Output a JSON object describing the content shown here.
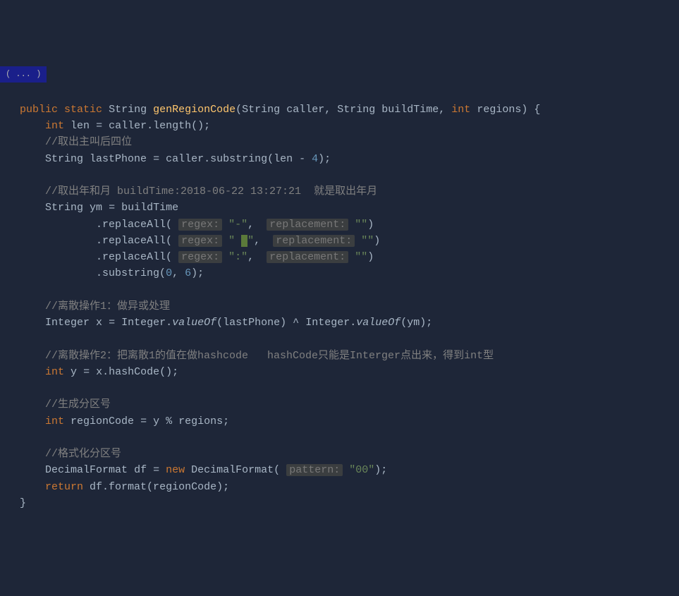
{
  "breadcrumb": "( ... )",
  "line1": {
    "kw_public": "public",
    "kw_static": "static",
    "type_string": "String",
    "method": "genRegionCode",
    "p1_type": "String",
    "p1_name": "caller",
    "p2_type": "String",
    "p2_name": "buildTime",
    "p3_type": "int",
    "p3_name": "regions"
  },
  "line2": {
    "kw_int": "int",
    "var": "len",
    "op": "=",
    "expr": "caller.length();"
  },
  "comment1": "//取出主叫后四位",
  "line3": {
    "type": "String",
    "var": "lastPhone",
    "op": "=",
    "expr_pre": "caller.substring(len - ",
    "num": "4",
    "expr_post": ");"
  },
  "comment2": "//取出年和月 buildTime:2018-06-22 13:27:21  就是取出年月",
  "line4": {
    "type": "String",
    "var": "ym",
    "op": "=",
    "rhs": "buildTime"
  },
  "repl1": {
    "call": ".replaceAll(",
    "hint1": "regex:",
    "str1a": "\"",
    "str1b": "-",
    "str1c": "\"",
    "comma": ", ",
    "hint2": "replacement:",
    "str2": "\"\"",
    "close": ")"
  },
  "repl2": {
    "call": ".replaceAll(",
    "hint1": "regex:",
    "str1": "\" ",
    "cursor": " ",
    "str1b": "\"",
    "comma": ", ",
    "hint2": "replacement:",
    "str2": "\"\"",
    "close": ")"
  },
  "repl3": {
    "call": ".replaceAll(",
    "hint1": "regex:",
    "str1": "\":\"",
    "comma": ", ",
    "hint2": "replacement:",
    "str2": "\"\"",
    "close": ")"
  },
  "substr": {
    "call": ".substring(",
    "n1": "0",
    "comma": ", ",
    "n2": "6",
    "close": ");"
  },
  "comment3": "//离散操作1：做异或处理",
  "line5": {
    "type": "Integer",
    "var": "x",
    "op": "=",
    "cls": "Integer",
    "dot": ".",
    "method": "valueOf",
    "arg1": "(lastPhone) ^ ",
    "cls2": "Integer",
    "dot2": ".",
    "method2": "valueOf",
    "arg2": "(ym);"
  },
  "comment4": "//离散操作2：把离散1的值在做hashcode   hashCode只能是Interger点出来，得到int型",
  "line6": {
    "kw_int": "int",
    "var": "y",
    "op": "=",
    "expr": "x.hashCode();"
  },
  "comment5": "//生成分区号",
  "line7": {
    "kw_int": "int",
    "var": "regionCode",
    "op": "=",
    "expr": "y % regions;"
  },
  "comment6": "//格式化分区号",
  "line8": {
    "type": "DecimalFormat",
    "var": "df",
    "op": "=",
    "kw_new": "new",
    "ctor": "DecimalFormat(",
    "hint": "pattern:",
    "str": "\"00\"",
    "close": ");"
  },
  "line9": {
    "kw_return": "return",
    "expr": "df.format(regionCode);"
  },
  "close_brace": "}"
}
